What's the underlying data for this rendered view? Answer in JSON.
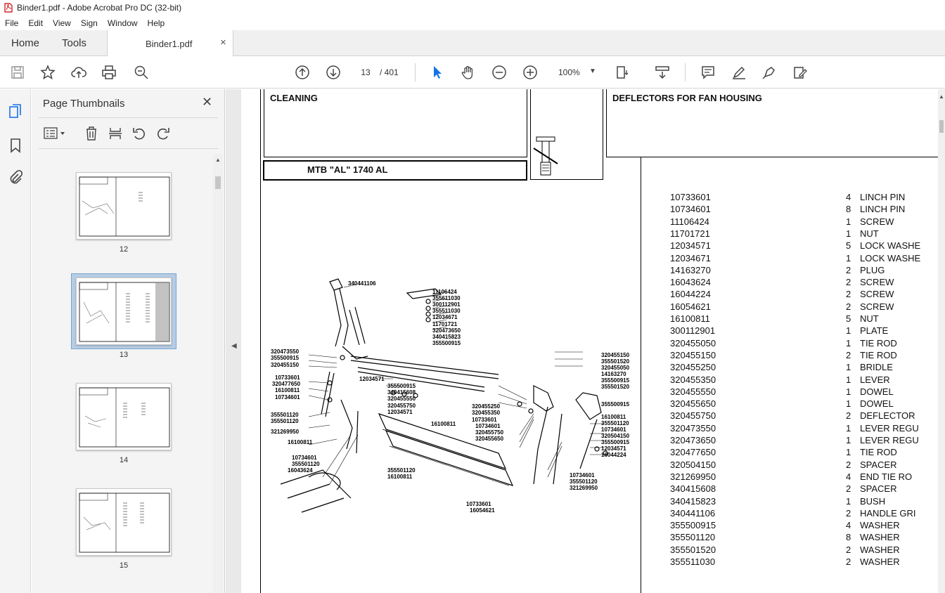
{
  "window": {
    "title": "Binder1.pdf - Adobe Acrobat Pro DC (32-bit)"
  },
  "menu": [
    "File",
    "Edit",
    "View",
    "Sign",
    "Window",
    "Help"
  ],
  "tabs": {
    "home": "Home",
    "tools": "Tools",
    "document": "Binder1.pdf",
    "close": "×"
  },
  "toolbar": {
    "page_current": "13",
    "page_total": "/ 401",
    "zoom": "100%"
  },
  "thumbnails_panel": {
    "title": "Page Thumbnails",
    "close": "✕",
    "pages": [
      "12",
      "13",
      "14",
      "15"
    ],
    "selected": "13"
  },
  "document": {
    "header_left": "CLEANING",
    "header_right": "DEFLECTORS FOR FAN HOUSING",
    "model": "MTB \"AL\" 1740 AL",
    "parts": [
      {
        "num": "10733601",
        "qty": "4",
        "desc": "LINCH PIN"
      },
      {
        "num": "10734601",
        "qty": "8",
        "desc": "LINCH PIN"
      },
      {
        "num": "11106424",
        "qty": "1",
        "desc": "SCREW"
      },
      {
        "num": "11701721",
        "qty": "1",
        "desc": "NUT"
      },
      {
        "num": "12034571",
        "qty": "5",
        "desc": "LOCK WASHE"
      },
      {
        "num": "12034671",
        "qty": "1",
        "desc": "LOCK WASHE"
      },
      {
        "num": "14163270",
        "qty": "2",
        "desc": "PLUG"
      },
      {
        "num": "16043624",
        "qty": "2",
        "desc": "SCREW"
      },
      {
        "num": "16044224",
        "qty": "2",
        "desc": "SCREW"
      },
      {
        "num": "16054621",
        "qty": "2",
        "desc": "SCREW"
      },
      {
        "num": "16100811",
        "qty": "5",
        "desc": "NUT"
      },
      {
        "num": "300112901",
        "qty": "1",
        "desc": "PLATE"
      },
      {
        "num": "320455050",
        "qty": "1",
        "desc": "TIE ROD"
      },
      {
        "num": "320455150",
        "qty": "2",
        "desc": "TIE ROD"
      },
      {
        "num": "320455250",
        "qty": "1",
        "desc": "BRIDLE"
      },
      {
        "num": "320455350",
        "qty": "1",
        "desc": "LEVER"
      },
      {
        "num": "320455550",
        "qty": "1",
        "desc": "DOWEL"
      },
      {
        "num": "320455650",
        "qty": "1",
        "desc": "DOWEL"
      },
      {
        "num": "320455750",
        "qty": "2",
        "desc": "DEFLECTOR"
      },
      {
        "num": "320473550",
        "qty": "1",
        "desc": "LEVER REGU"
      },
      {
        "num": "320473650",
        "qty": "1",
        "desc": "LEVER REGU"
      },
      {
        "num": "320477650",
        "qty": "1",
        "desc": "TIE ROD"
      },
      {
        "num": "320504150",
        "qty": "2",
        "desc": "SPACER"
      },
      {
        "num": "321269950",
        "qty": "4",
        "desc": "END TIE RO"
      },
      {
        "num": "340415608",
        "qty": "2",
        "desc": "SPACER"
      },
      {
        "num": "340415823",
        "qty": "1",
        "desc": "BUSH"
      },
      {
        "num": "340441106",
        "qty": "2",
        "desc": "HANDLE GRI"
      },
      {
        "num": "355500915",
        "qty": "4",
        "desc": "WASHER"
      },
      {
        "num": "355501120",
        "qty": "8",
        "desc": "WASHER"
      },
      {
        "num": "355501520",
        "qty": "2",
        "desc": "WASHER"
      },
      {
        "num": "355511030",
        "qty": "2",
        "desc": "WASHER"
      }
    ],
    "callouts": [
      "340441106",
      "11106424",
      "355611030",
      "300112901",
      "355511030",
      "12034671",
      "11701721",
      "320473650",
      "340415823",
      "355500915",
      "320473550",
      "355500915",
      "320455150",
      "10733601",
      "320477650",
      "16100811",
      "10734601",
      "355501120",
      "355501120",
      "321269950",
      "16100811",
      "10734601",
      "355501120",
      "16043624",
      "12034571",
      "355500915",
      "340415608",
      "320455550",
      "320455750",
      "12034571",
      "16100811",
      "10734601",
      "320455750",
      "320455650",
      "355501120",
      "16100811",
      "10733601",
      "16054621",
      "320455150",
      "355501520",
      "320455050",
      "14163270",
      "355500915",
      "355501520",
      "320455250",
      "320455350",
      "10733601",
      "355500915",
      "16100811",
      "355501120",
      "10734601",
      "320504150",
      "355500915",
      "12034571",
      "16044224",
      "10734601",
      "355501120",
      "321269950"
    ]
  },
  "colors": {
    "accent": "#1473e6",
    "selection": "#b7cde4"
  }
}
